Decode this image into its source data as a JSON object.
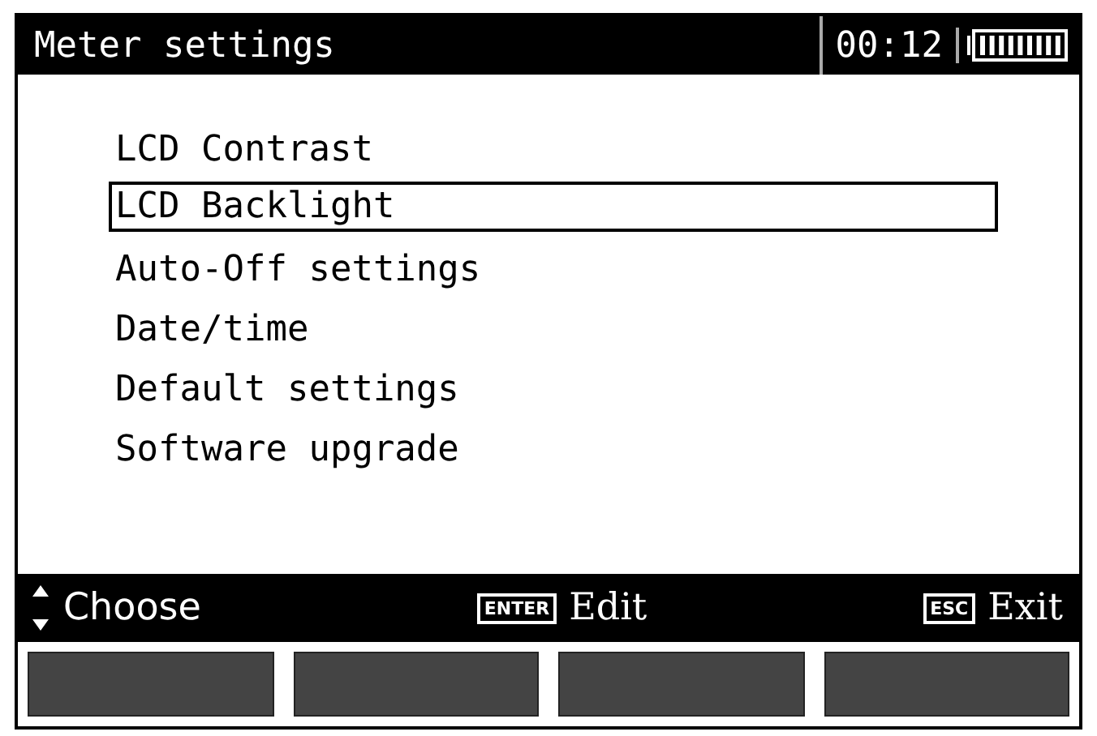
{
  "header": {
    "title": "Meter settings",
    "time": "00:12"
  },
  "menu": [
    {
      "label": "LCD Contrast",
      "selected": false
    },
    {
      "label": "LCD Backlight",
      "selected": true
    },
    {
      "label": "Auto-Off settings",
      "selected": false
    },
    {
      "label": "Date/time",
      "selected": false
    },
    {
      "label": "Default settings",
      "selected": false
    },
    {
      "label": "Software upgrade",
      "selected": false
    }
  ],
  "hints": [
    {
      "kind": "arrows",
      "label": "Choose"
    },
    {
      "kind": "key",
      "key": "ENTER",
      "label": "Edit"
    },
    {
      "kind": "key",
      "key": "ESC",
      "label": "Exit"
    }
  ]
}
